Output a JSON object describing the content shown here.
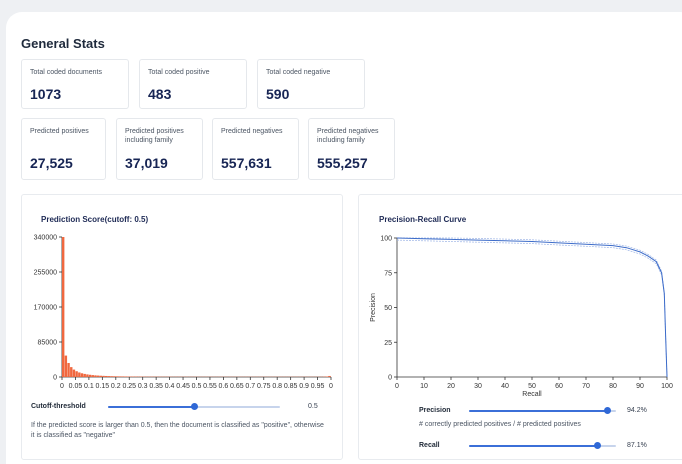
{
  "general": {
    "title": "General Stats",
    "row1": [
      {
        "label": "Total coded documents",
        "value": "1073"
      },
      {
        "label": "Total coded positive",
        "value": "483"
      },
      {
        "label": "Total coded negative",
        "value": "590"
      }
    ],
    "row2": [
      {
        "label": "Predicted positives",
        "value": "27,525"
      },
      {
        "label": "Predicted positives including family",
        "value": "37,019"
      },
      {
        "label": "Predicted negatives",
        "value": "557,631"
      },
      {
        "label": "Predicted negatives including family",
        "value": "555,257"
      }
    ]
  },
  "prediction": {
    "title": "Prediction Score(cutoff: 0.5)",
    "cutoff_label": "Cutoff-threshold",
    "cutoff_value": "0.5",
    "cutoff_fraction": 0.5,
    "note": "If the predicted score is larger than 0.5, then the document is classified as \"positive\", otherwise it is classified as \"negative\""
  },
  "pr": {
    "title": "Precision-Recall Curve",
    "precision_label": "Precision",
    "precision_value": "94.2%",
    "precision_fraction": 0.942,
    "precision_note": "# correctly predicted positives / # predicted positives",
    "recall_label": "Recall",
    "recall_value": "87.1%",
    "recall_fraction": 0.871
  },
  "chart_data": [
    {
      "type": "bar",
      "title": "Prediction Score(cutoff: 0.5)",
      "xlabel": "",
      "ylabel": "",
      "ylim": [
        0,
        340000
      ],
      "y_ticks": [
        "0",
        "85000",
        "170000",
        "255000",
        "340000"
      ],
      "x_ticks": [
        "0",
        "0.05",
        "0.1",
        "0.15",
        "0.2",
        "0.25",
        "0.3",
        "0.35",
        "0.4",
        "0.45",
        "0.5",
        "0.55",
        "0.6",
        "0.65",
        "0.7",
        "0.75",
        "0.8",
        "0.85",
        "0.9",
        "0.95",
        "0"
      ],
      "bin_width": 0.01,
      "values": [
        340000,
        52000,
        34000,
        24000,
        18000,
        14000,
        11000,
        9000,
        7500,
        6300,
        5400,
        4600,
        4000,
        3500,
        3100,
        2800,
        2500,
        2200,
        2000,
        1800,
        1600,
        1500,
        1400,
        1300,
        1200,
        1100,
        1050,
        1000,
        950,
        900,
        850,
        800,
        780,
        760,
        740,
        720,
        700,
        680,
        660,
        640,
        620,
        600,
        590,
        580,
        570,
        560,
        550,
        540,
        530,
        520,
        510,
        500,
        500,
        500,
        500,
        500,
        500,
        500,
        500,
        500,
        500,
        500,
        500,
        500,
        500,
        500,
        500,
        500,
        500,
        500,
        500,
        500,
        500,
        500,
        500,
        500,
        500,
        500,
        500,
        500,
        500,
        500,
        500,
        500,
        500,
        500,
        500,
        500,
        500,
        500,
        500,
        500,
        500,
        500,
        500,
        500,
        600,
        800,
        1200,
        2500
      ]
    },
    {
      "type": "line",
      "title": "Precision-Recall Curve",
      "xlabel": "Recall",
      "ylabel": "Precision",
      "xlim": [
        0,
        100
      ],
      "ylim": [
        0,
        100
      ],
      "x_ticks": [
        "0",
        "10",
        "20",
        "30",
        "40",
        "50",
        "60",
        "70",
        "80",
        "90",
        "100"
      ],
      "y_ticks": [
        "0",
        "25",
        "50",
        "75",
        "100"
      ],
      "series": [
        {
          "values": [
            [
              0,
              100
            ],
            [
              10,
              99.5
            ],
            [
              20,
              99
            ],
            [
              30,
              98.5
            ],
            [
              40,
              98
            ],
            [
              50,
              97.5
            ],
            [
              60,
              96.5
            ],
            [
              70,
              95.5
            ],
            [
              80,
              94.5
            ],
            [
              85,
              93
            ],
            [
              90,
              90
            ],
            [
              93,
              87
            ],
            [
              96,
              83
            ],
            [
              98,
              75
            ],
            [
              99,
              60
            ],
            [
              99.5,
              30
            ],
            [
              100,
              0
            ]
          ]
        }
      ]
    }
  ]
}
